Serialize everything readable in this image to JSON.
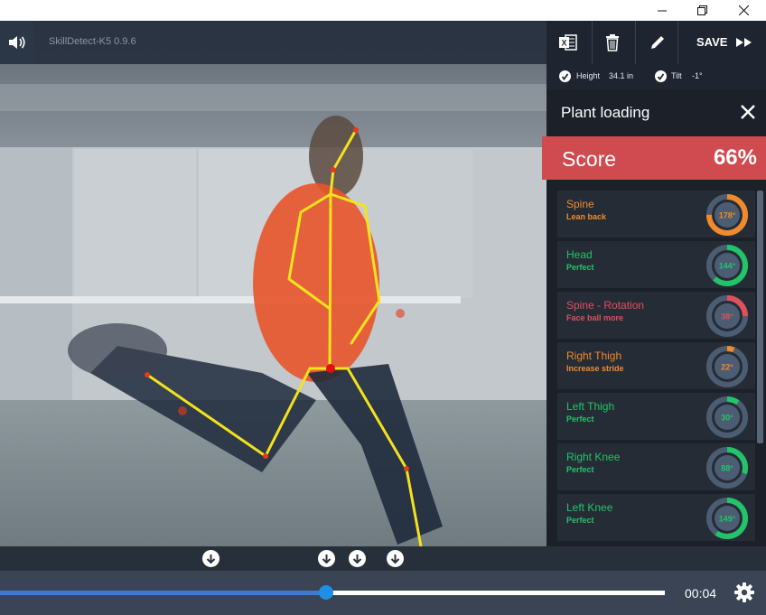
{
  "app": {
    "title": "SkillDetect-K5 0.9.6",
    "save_label": "SAVE"
  },
  "info": {
    "height_label": "Height",
    "height_value": "34.1 in",
    "tilt_label": "Tilt",
    "tilt_value": "-1°"
  },
  "panel": {
    "title": "Plant loading",
    "score_label": "Score",
    "score_value": "66%",
    "metrics": [
      {
        "name": "Spine",
        "sub": "Lean back",
        "value": "178°",
        "color": "#f08a2b",
        "fraction": 0.75
      },
      {
        "name": "Head",
        "sub": "Perfect",
        "value": "144°",
        "color": "#22c46a",
        "fraction": 0.62
      },
      {
        "name": "Spine - Rotation",
        "sub": "Face ball more",
        "value": "38°",
        "color": "#e0505c",
        "fraction": 0.25
      },
      {
        "name": "Right Thigh",
        "sub": "Increase stride",
        "value": "22°",
        "color": "#f08a2b",
        "fraction": 0.06
      },
      {
        "name": "Left Thigh",
        "sub": "Perfect",
        "value": "30°",
        "color": "#22c46a",
        "fraction": 0.1
      },
      {
        "name": "Right Knee",
        "sub": "Perfect",
        "value": "88°",
        "color": "#22c46a",
        "fraction": 0.3
      },
      {
        "name": "Left Knee",
        "sub": "Perfect",
        "value": "149°",
        "color": "#22c46a",
        "fraction": 0.6
      }
    ]
  },
  "playback": {
    "time": "00:04",
    "progress": 0.49
  },
  "icons": {
    "volume": "volume-icon",
    "excel": "excel-icon",
    "delete": "trash-icon",
    "edit": "pencil-icon",
    "save": "fast-forward-icon",
    "close": "close-icon",
    "settings": "gear-icon",
    "marker": "arrow-down-icon"
  }
}
